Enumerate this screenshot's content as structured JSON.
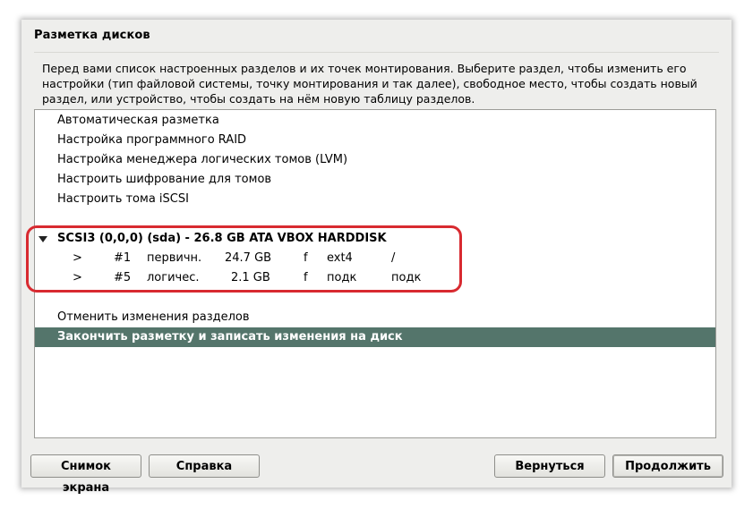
{
  "window": {
    "title": "Разметка дисков",
    "description": [
      "Перед вами список настроенных разделов и их точек монтирования. Выберите раздел, чтобы изменить его",
      "настройки (тип файловой системы, точку монтирования и так далее), свободное место, чтобы создать новый",
      "раздел, или устройство, чтобы создать на нём новую таблицу разделов."
    ]
  },
  "list": {
    "options": [
      "Автоматическая разметка",
      "Настройка программного RAID",
      "Настройка менеджера логических томов (LVM)",
      "Настроить шифрование для томов",
      "Настроить тома iSCSI"
    ],
    "disk": {
      "label": "SCSI3 (0,0,0) (sda) - 26.8 GB ATA VBOX HARDDISK",
      "partitions": [
        {
          "arrow": ">",
          "num": "#1",
          "type": "первичн.",
          "size": "24.7 GB",
          "flag": "f",
          "fs": "ext4",
          "mount": "/"
        },
        {
          "arrow": ">",
          "num": "#5",
          "type": "логичес.",
          "size": "2.1 GB",
          "flag": "f",
          "fs": "подк",
          "mount": "подк"
        }
      ]
    },
    "undo": "Отменить изменения разделов",
    "finish": "Закончить разметку и записать изменения на диск",
    "selected_item": "finish"
  },
  "buttons": {
    "screenshot": "Снимок экрана",
    "help": "Справка",
    "back": "Вернуться",
    "continue": "Продолжить"
  },
  "colors": {
    "selection": "#54756b",
    "highlight_frame": "#d82a30"
  }
}
